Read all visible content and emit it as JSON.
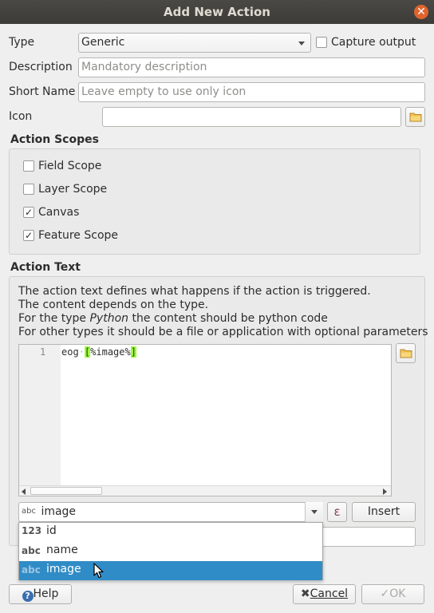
{
  "window": {
    "title": "Add New Action"
  },
  "form": {
    "type_label": "Type",
    "type_value": "Generic",
    "capture_output_label": "Capture output",
    "capture_output_checked": false,
    "description_label": "Description",
    "description_placeholder": "Mandatory description",
    "short_name_label": "Short Name",
    "short_name_placeholder": "Leave empty to use only icon",
    "icon_label": "Icon",
    "icon_value": ""
  },
  "scopes": {
    "title": "Action Scopes",
    "items": [
      {
        "label": "Field Scope",
        "checked": false
      },
      {
        "label": "Layer Scope",
        "checked": false
      },
      {
        "label": "Canvas",
        "checked": true
      },
      {
        "label": "Feature Scope",
        "checked": true
      }
    ]
  },
  "action_text": {
    "title": "Action Text",
    "help_line1": "The action text defines what happens if the action is triggered.",
    "help_line2": "The content depends on the type.",
    "help_line3_pre": "For the type ",
    "help_line3_italic": "Python",
    "help_line3_post": " the content should be python code",
    "help_line4": "For other types it should be a file or application with optional parameters",
    "editor": {
      "line_number": "1",
      "code_word": "eog",
      "code_open": "[",
      "code_expr": "%image%",
      "code_close": "]"
    }
  },
  "field_combo": {
    "type_badge": "abc",
    "value": "image",
    "insert_label": "Insert",
    "expression_symbol": "ε",
    "options": [
      {
        "badge": "123",
        "label": "id",
        "selected": false
      },
      {
        "badge": "abc",
        "label": "name",
        "selected": false
      },
      {
        "badge": "abc",
        "label": "image",
        "selected": true
      }
    ]
  },
  "buttons": {
    "help": "Help",
    "cancel": "Cancel",
    "ok": "OK"
  },
  "colors": {
    "selection": "#308cc6",
    "titlebar": "#3c3b37",
    "close": "#e0632f",
    "highlight": "#9bff36"
  }
}
